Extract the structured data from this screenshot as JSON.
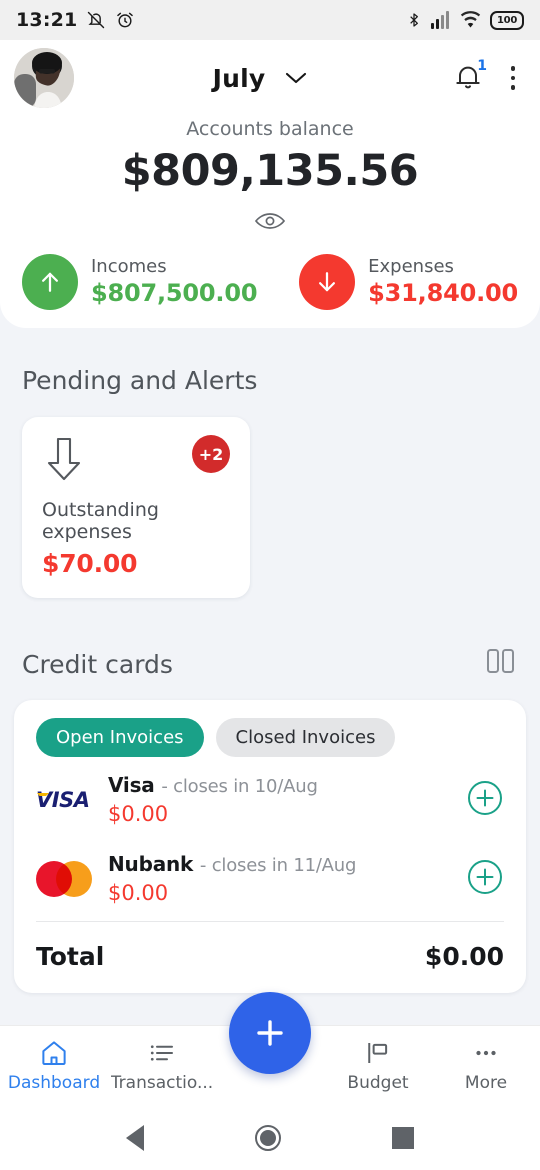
{
  "status_bar": {
    "time": "13:21",
    "icons_left": [
      "mute-icon",
      "alarm-icon"
    ],
    "icons_right": [
      "bluetooth-icon",
      "cellular-signal-icon",
      "wifi-icon"
    ],
    "battery_level": "100"
  },
  "app_bar": {
    "avatar": "user-avatar",
    "month": "July",
    "chevron": "chevron-down-icon",
    "notification_count": "1",
    "overflow": "kebab-menu-icon"
  },
  "balance": {
    "label": "Accounts balance",
    "amount": "$809,135.56",
    "visibility_icon": "eye-icon",
    "incomes": {
      "label": "Incomes",
      "amount": "$807,500.00",
      "color": "#4caf50",
      "icon": "arrow-up-icon"
    },
    "expenses": {
      "label": "Expenses",
      "amount": "$31,840.00",
      "color": "#f4392f",
      "icon": "arrow-down-icon"
    }
  },
  "pending": {
    "title": "Pending and Alerts",
    "card": {
      "icon": "arrow-down-outline-icon",
      "badge": "+2",
      "label": "Outstanding expenses",
      "amount": "$70.00",
      "amount_color": "#f4392f"
    }
  },
  "credit_cards": {
    "title": "Credit cards",
    "view_toggle_icon": "columns-view-icon",
    "tabs": [
      {
        "label": "Open Invoices",
        "active": true
      },
      {
        "label": "Closed Invoices",
        "active": false
      }
    ],
    "accent_color": "#1aa188",
    "rows": [
      {
        "brand": "Visa",
        "logo": "visa-logo",
        "closing": "- closes in 10/Aug",
        "amount": "$0.00",
        "action": "add-icon"
      },
      {
        "brand": "Nubank",
        "logo": "mastercard-logo",
        "closing": "- closes in 11/Aug",
        "amount": "$0.00",
        "action": "add-icon"
      }
    ],
    "total_label": "Total",
    "total_value": "$0.00"
  },
  "bottom_nav": {
    "fab_icon": "plus-icon",
    "fab_color": "#2f63e8",
    "items": [
      {
        "label": "Dashboard",
        "icon": "home-icon",
        "active": true
      },
      {
        "label": "Transactio...",
        "icon": "list-icon",
        "active": false
      },
      {
        "label": "Budget",
        "icon": "flag-icon",
        "active": false
      },
      {
        "label": "More",
        "icon": "ellipsis-icon",
        "active": false
      }
    ]
  },
  "android_nav": {
    "back": "back-triangle-icon",
    "home": "home-circle-icon",
    "recents": "recents-square-icon"
  }
}
